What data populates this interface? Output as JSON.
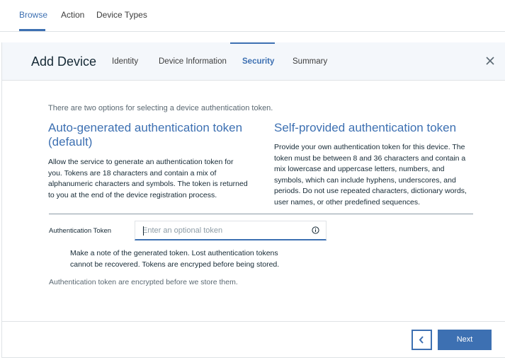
{
  "topnav": {
    "tabs": [
      {
        "label": "Browse",
        "active": true
      },
      {
        "label": "Action",
        "active": false
      },
      {
        "label": "Device Types",
        "active": false
      }
    ]
  },
  "modal": {
    "title": "Add Device",
    "steps": [
      {
        "label": "Identity",
        "active": false
      },
      {
        "label": "Device Information",
        "active": false
      },
      {
        "label": "Security",
        "active": true
      },
      {
        "label": "Summary",
        "active": false
      }
    ],
    "close_icon": "close-icon"
  },
  "content": {
    "intro": "There are two options for selecting a device authentication token.",
    "auto": {
      "title_line1": "Auto-generated authentication token",
      "title_line2": "(default)",
      "lines": [
        "Allow the service to generate an authentication token for",
        "you. Tokens are 18 characters and contain a mix of",
        "alphanumeric characters and symbols. The token is returned",
        "to you at the end of the device registration process."
      ]
    },
    "self": {
      "title": "Self-provided authentication token",
      "lines": [
        "Provide your own authentication token for this device. The",
        "token must be between 8 and 36 characters and contain a",
        "mix lowercase and uppercase letters, numbers, and",
        "symbols, which can include hyphens, underscores, and",
        "periods. Do not use repeated characters, dictionary words,",
        "user names, or other predefined sequences."
      ]
    },
    "field": {
      "label": "Authentication Token",
      "placeholder": "Enter an optional token",
      "value": "",
      "info_icon": "info-icon"
    },
    "note_lines": [
      "Make a note of the generated token. Lost authentication tokens",
      "cannot be recovered. Tokens are encryped before being stored."
    ],
    "footnote": "Authentication token are encrypted before we store them."
  },
  "footer": {
    "back_icon": "chevron-left-icon",
    "next_label": "Next"
  },
  "colors": {
    "accent": "#3d70b2",
    "header_bg": "#f4f7fb",
    "text": "#152935"
  }
}
